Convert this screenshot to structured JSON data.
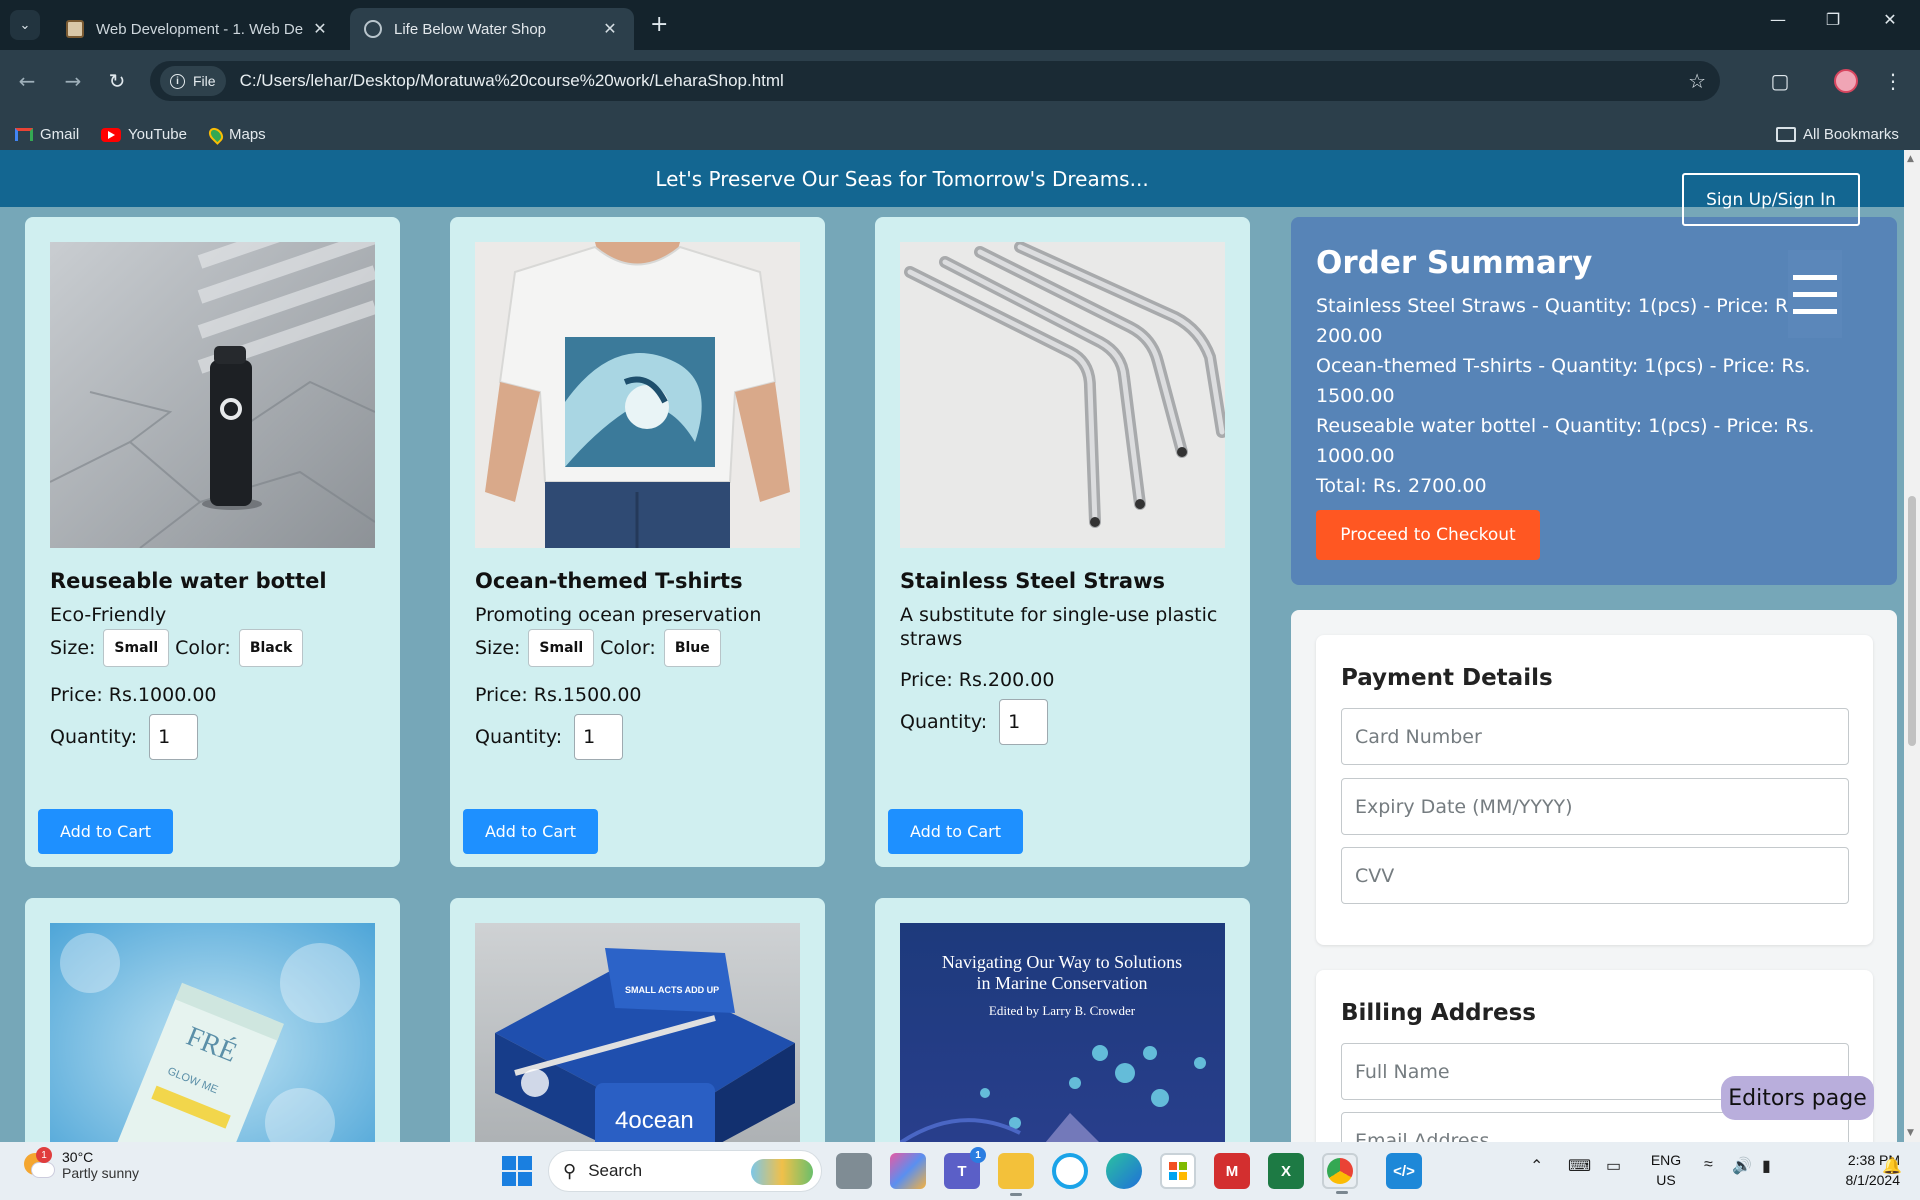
{
  "browser": {
    "tabs": [
      {
        "title": "Web Development - 1. Web De",
        "active": false
      },
      {
        "title": "Life Below Water Shop",
        "active": true
      }
    ],
    "new_tab_symbol": "+",
    "address_chip": "File",
    "url": "C:/Users/lehar/Desktop/Moratuwa%20course%20work/LeharaShop.html",
    "bookmarks": [
      "Gmail",
      "YouTube",
      "Maps"
    ],
    "all_bookmarks": "All Bookmarks"
  },
  "page": {
    "banner_text": "Let's Preserve Our Seas for Tomorrow's Dreams...",
    "signin_label": "Sign Up/Sign In",
    "products": [
      {
        "name": "Reuseable water bottel",
        "description": "Eco-Friendly",
        "size_label": "Size:",
        "size_value": "Small",
        "color_label": "Color:",
        "color_value": "Black",
        "price": "Price: Rs.1000.00",
        "quantity_label": "Quantity:",
        "quantity_value": "1",
        "add_label": "Add to Cart"
      },
      {
        "name": "Ocean-themed T-shirts",
        "description": "Promoting ocean preservation",
        "size_label": "Size:",
        "size_value": "Small",
        "color_label": "Color:",
        "color_value": "Blue",
        "price": "Price: Rs.1500.00",
        "quantity_label": "Quantity:",
        "quantity_value": "1",
        "add_label": "Add to Cart"
      },
      {
        "name": "Stainless Steel Straws",
        "description": "A substitute for single-use plastic straws",
        "price": "Price: Rs.200.00",
        "quantity_label": "Quantity:",
        "quantity_value": "1",
        "add_label": "Add to Cart"
      }
    ],
    "book_cover": {
      "line1": "Navigating Our Way to Solutions",
      "line2": "in Marine Conservation",
      "line3": "Edited by Larry B. Crowder"
    },
    "tote_text": "SMALL ACTS ADD UP",
    "brand_4ocean": "4ocean",
    "tube_brand": "FRÉ",
    "tube_text": "GLOW ME",
    "order_summary": {
      "title": "Order Summary",
      "lines": [
        "Stainless Steel Straws - Quantity: 1(pcs) - Price: Rs. 200.00",
        "Ocean-themed T-shirts - Quantity: 1(pcs) - Price: Rs. 1500.00",
        "Reuseable water bottel - Quantity: 1(pcs) - Price: Rs. 1000.00"
      ],
      "total": "Total: Rs. 2700.00",
      "checkout_label": "Proceed to Checkout"
    },
    "payment": {
      "title": "Payment Details",
      "card_placeholder": "Card Number",
      "expiry_placeholder": "Expiry Date (MM/YYYY)",
      "cvv_placeholder": "CVV"
    },
    "billing": {
      "title": "Billing Address",
      "name_placeholder": "Full Name",
      "email_placeholder": "Email Address"
    },
    "editors_label": "Editors page"
  },
  "taskbar": {
    "weather_temp": "30°C",
    "weather_condition": "Partly sunny",
    "weather_badge": "1",
    "search_placeholder": "Search",
    "teams_badge": "1",
    "language_line1": "ENG",
    "language_line2": "US",
    "time": "2:38 PM",
    "date": "8/1/2024"
  },
  "colors": {
    "page_background": "#76a7b8",
    "banner": "#136691",
    "card": "#d0eff0",
    "add_button": "#1e90ff",
    "summary_panel": "#5784b7",
    "checkout_button": "#ff5722",
    "editors_chip": "#b9aedc"
  },
  "icons": [
    "back-icon",
    "forward-icon",
    "reload-icon",
    "info-icon",
    "star-icon",
    "extensions-icon",
    "profile-icon",
    "menu-dots-icon",
    "hamburger-menu-icon",
    "windows-start-icon",
    "search-icon"
  ]
}
